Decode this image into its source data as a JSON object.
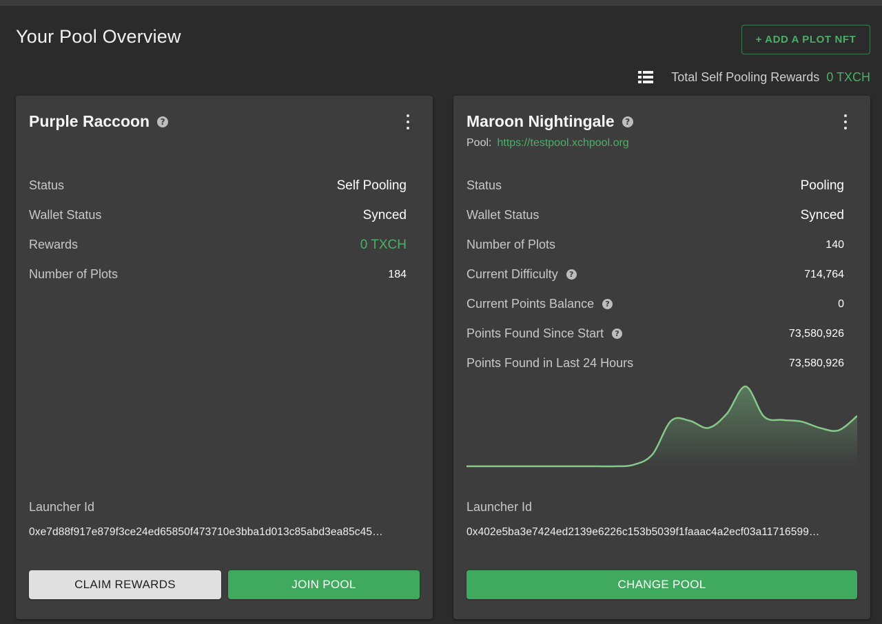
{
  "header": {
    "title": "Your Pool Overview",
    "add_button_label": "+ ADD A PLOT NFT",
    "total_rewards_label": "Total Self Pooling Rewards",
    "total_rewards_value": "0 TXCH"
  },
  "cards": [
    {
      "name": "Purple Raccoon",
      "rows": [
        {
          "label": "Status",
          "value": "Self Pooling"
        },
        {
          "label": "Wallet Status",
          "value": "Synced"
        },
        {
          "label": "Rewards",
          "value": "0 TXCH"
        },
        {
          "label": "Number of Plots",
          "value": "184"
        }
      ],
      "launcher_label": "Launcher Id",
      "launcher_id": "0xe7d88f917e879f3ce24ed65850f473710e3bba1d013c85abd3ea85c45…",
      "buttons": {
        "claim": "CLAIM REWARDS",
        "join": "JOIN POOL"
      }
    },
    {
      "name": "Maroon Nightingale",
      "pool_label": "Pool:",
      "pool_url": "https://testpool.xchpool.org",
      "rows": [
        {
          "label": "Status",
          "value": "Pooling"
        },
        {
          "label": "Wallet Status",
          "value": "Synced"
        },
        {
          "label": "Number of Plots",
          "value": "140"
        },
        {
          "label": "Current Difficulty",
          "value": "714,764"
        },
        {
          "label": "Current Points Balance",
          "value": "0"
        },
        {
          "label": "Points Found Since Start",
          "value": "73,580,926"
        },
        {
          "label": "Points Found in Last 24 Hours",
          "value": "73,580,926"
        }
      ],
      "launcher_label": "Launcher Id",
      "launcher_id": "0x402e5ba3e7424ed2139e6226c153b5039f1faaac4a2ecf03a11716599…",
      "buttons": {
        "change": "CHANGE POOL"
      }
    }
  ],
  "colors": {
    "accent": "#4caf67",
    "button_green": "#3fa95e",
    "card_bg": "#3d3d3d",
    "page_bg": "#2b2b2b"
  },
  "icons": {
    "list": "list-view-icon",
    "help": "help-circle-icon",
    "more": "more-vertical-icon"
  },
  "chart_data": {
    "type": "area",
    "values": [
      0,
      0,
      0,
      0,
      0,
      0,
      0,
      0,
      0,
      0.02,
      0.15,
      0.57,
      0.57,
      0.48,
      0.66,
      1.0,
      0.62,
      0.58,
      0.56,
      0.48,
      0.45,
      0.63
    ]
  }
}
